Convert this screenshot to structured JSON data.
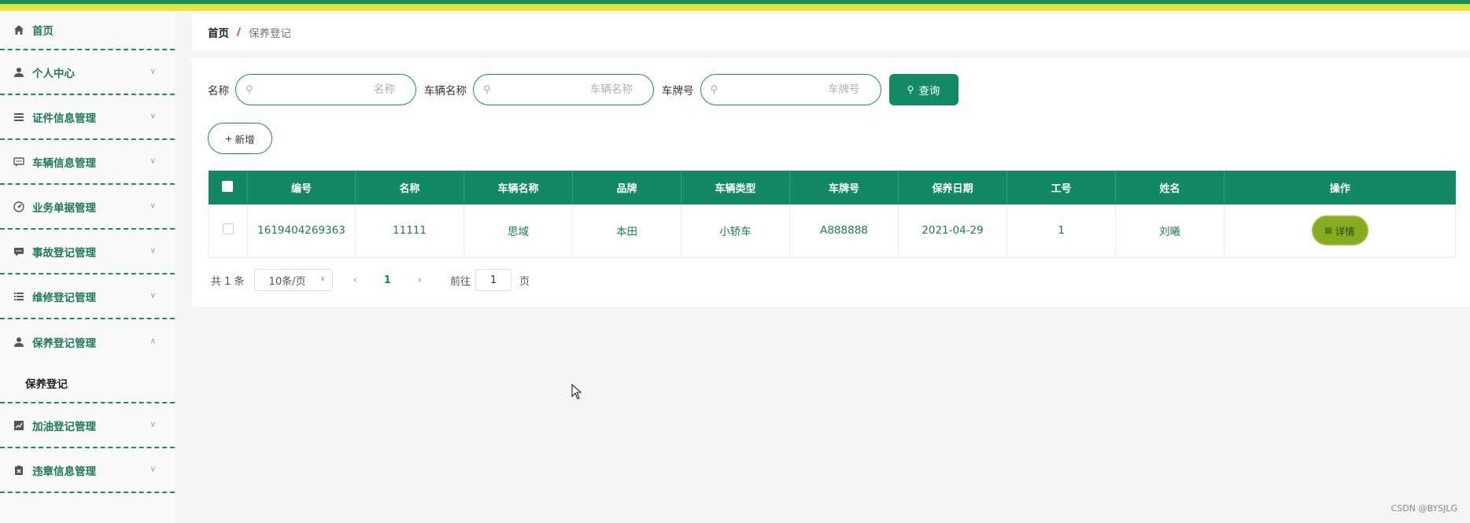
{
  "sidebar": {
    "items": [
      {
        "label": "首页",
        "icon": "home-icon"
      },
      {
        "label": "个人中心",
        "icon": "user-icon"
      },
      {
        "label": "证件信息管理",
        "icon": "list-icon"
      },
      {
        "label": "车辆信息管理",
        "icon": "chat-icon"
      },
      {
        "label": "业务单据管理",
        "icon": "gauge-icon"
      },
      {
        "label": "事故登记管理",
        "icon": "message-icon"
      },
      {
        "label": "维修登记管理",
        "icon": "menu-icon"
      },
      {
        "label": "保养登记管理",
        "icon": "user-icon",
        "expanded": true
      },
      {
        "label": "加油登记管理",
        "icon": "chart-icon"
      },
      {
        "label": "违章信息管理",
        "icon": "clipboard-icon"
      }
    ],
    "submenu_active": "保养登记"
  },
  "breadcrumb": {
    "home": "首页",
    "sep": "/",
    "current": "保养登记"
  },
  "search": {
    "fields": [
      {
        "label": "名称",
        "placeholder": "名称",
        "value": ""
      },
      {
        "label": "车辆名称",
        "placeholder": "车辆名称",
        "value": ""
      },
      {
        "label": "车牌号",
        "placeholder": "车牌号",
        "value": ""
      }
    ],
    "query_label": "查询"
  },
  "add_label": "新增",
  "table": {
    "headers": [
      "编号",
      "名称",
      "车辆名称",
      "品牌",
      "车辆类型",
      "车牌号",
      "保养日期",
      "工号",
      "姓名",
      "操作"
    ],
    "rows": [
      {
        "cells": [
          "1619404269363",
          "11111",
          "思域",
          "本田",
          "小轿车",
          "A888888",
          "2021-04-29",
          "1",
          "刘曦"
        ],
        "action": "详情"
      }
    ]
  },
  "pager": {
    "total": "共 1 条",
    "page_size": "10条/页",
    "current_page": "1",
    "goto_label": "前往",
    "goto_value": "1",
    "page_suffix": "页"
  },
  "watermark": "CSDN @BYSJLG",
  "colors": {
    "accent": "#128a66",
    "detail_button": "#85ab1f",
    "topbar_green": "#1b8b5e",
    "topbar_yellow": "#eaea3a"
  }
}
